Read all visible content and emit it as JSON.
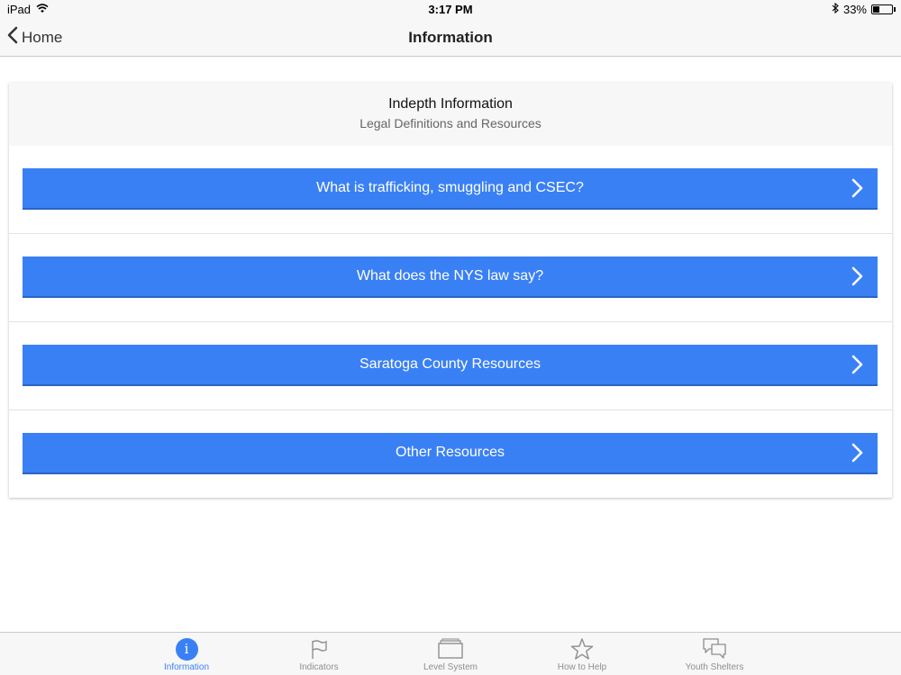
{
  "status_bar": {
    "device": "iPad",
    "time": "3:17 PM",
    "battery": "33%",
    "battery_level": 0.33,
    "icons": [
      "wifi-icon",
      "bluetooth-icon",
      "battery-icon"
    ]
  },
  "nav": {
    "back_label": "Home",
    "title": "Information"
  },
  "card": {
    "title": "Indepth Information",
    "subtitle": "Legal Definitions and Resources",
    "items": [
      {
        "label": "What is trafficking, smuggling and CSEC?"
      },
      {
        "label": "What does the NYS law say?"
      },
      {
        "label": "Saratoga County Resources"
      },
      {
        "label": "Other Resources"
      }
    ]
  },
  "tabs": [
    {
      "label": "Information",
      "icon": "info-icon",
      "active": true
    },
    {
      "label": "Indicators",
      "icon": "flag-icon",
      "active": false
    },
    {
      "label": "Level System",
      "icon": "folder-icon",
      "active": false
    },
    {
      "label": "How to Help",
      "icon": "star-icon",
      "active": false
    },
    {
      "label": "Youth Shelters",
      "icon": "chat-bubbles-icon",
      "active": false
    }
  ],
  "colors": {
    "accent": "#3a80f5",
    "bar_background": "#f7f7f7",
    "inactive_tab": "#8e8e93"
  }
}
